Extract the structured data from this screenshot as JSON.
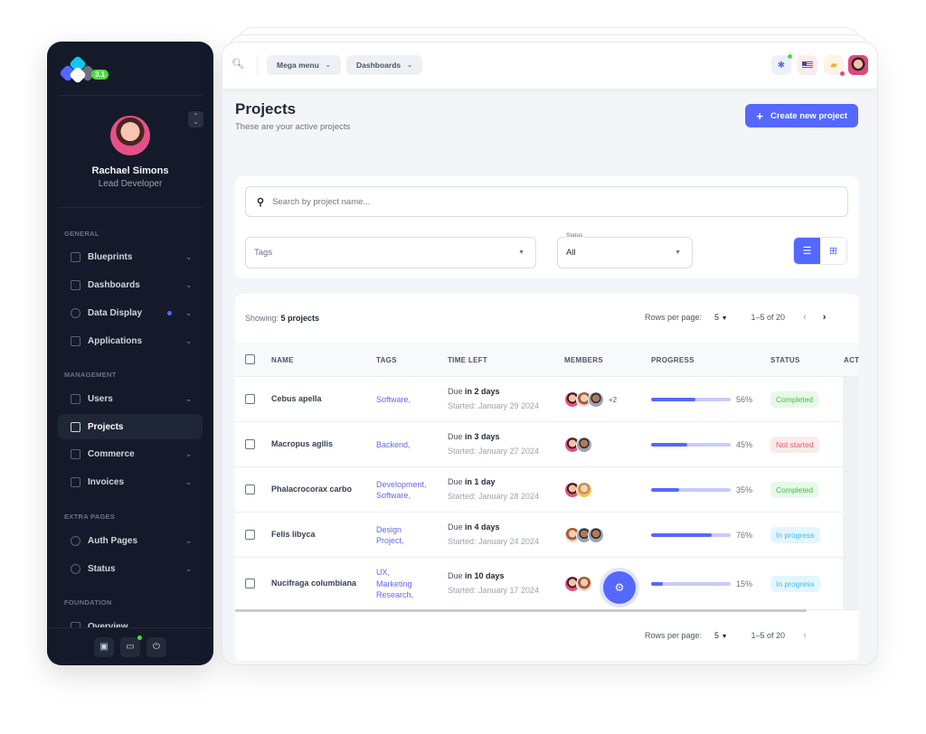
{
  "app": {
    "version": "3.1"
  },
  "user": {
    "name": "Rachael Simons",
    "role": "Lead Developer"
  },
  "sidebar": {
    "sections": [
      {
        "title": "GENERAL",
        "items": [
          {
            "label": "Blueprints",
            "icon": "blueprint-icon"
          },
          {
            "label": "Dashboards",
            "icon": "robot-icon"
          },
          {
            "label": "Data Display",
            "icon": "shield-icon",
            "dot": true
          },
          {
            "label": "Applications",
            "icon": "app-window-icon"
          }
        ]
      },
      {
        "title": "MANAGEMENT",
        "items": [
          {
            "label": "Users",
            "icon": "user-badge-icon"
          },
          {
            "label": "Projects",
            "icon": "hierarchy-icon",
            "active": true
          },
          {
            "label": "Commerce",
            "icon": "store-icon"
          },
          {
            "label": "Invoices",
            "icon": "invoice-icon"
          }
        ]
      },
      {
        "title": "EXTRA PAGES",
        "items": [
          {
            "label": "Auth Pages",
            "icon": "key-icon"
          },
          {
            "label": "Status",
            "icon": "alert-circle-icon"
          }
        ]
      },
      {
        "title": "FOUNDATION",
        "items": [
          {
            "label": "Overview",
            "icon": "grid-x-icon"
          }
        ]
      }
    ],
    "footer": {
      "calendar": "calendar-icon",
      "chat": "chat-icon",
      "power": "power-icon"
    }
  },
  "topbar": {
    "mega_menu": "Mega menu",
    "dashboards": "Dashboards",
    "icons": [
      "bug-icon",
      "us-flag-icon",
      "messages-icon"
    ]
  },
  "page": {
    "title": "Projects",
    "subtitle": "These are your active projects",
    "create_button": "Create new project"
  },
  "filters": {
    "search_placeholder": "Search by project name...",
    "tags_placeholder": "Tags",
    "status_label": "Status",
    "status_value": "All"
  },
  "table": {
    "showing_prefix": "Showing:",
    "showing_count": "5 projects",
    "rows_per_page_label": "Rows per page:",
    "rows_per_page": "5",
    "range": "1–5 of 20",
    "columns": [
      "NAME",
      "TAGS",
      "TIME LEFT",
      "MEMBERS",
      "PROGRESS",
      "STATUS",
      "ACT"
    ],
    "rows": [
      {
        "name": "Cebus apella",
        "tags": [
          "Software,"
        ],
        "due_prefix": "Due",
        "due": "in 2 days",
        "started": "Started: January 29 2024",
        "members": 3,
        "extra_members": "+2",
        "progress": 56,
        "progress_label": "56%",
        "status": "Completed"
      },
      {
        "name": "Macropus agilis",
        "tags": [
          "Backend,"
        ],
        "due_prefix": "Due",
        "due": "in 3 days",
        "started": "Started: January 27 2024",
        "members": 2,
        "extra_members": "",
        "progress": 45,
        "progress_label": "45%",
        "status": "Not started"
      },
      {
        "name": "Phalacrocorax carbo",
        "tags": [
          "Development,",
          "Software,"
        ],
        "due_prefix": "Due",
        "due": "in 1 day",
        "started": "Started: January 28 2024",
        "members": 2,
        "extra_members": "",
        "progress": 35,
        "progress_label": "35%",
        "status": "Completed"
      },
      {
        "name": "Felis libyca",
        "tags": [
          "Design",
          "Project,"
        ],
        "due_prefix": "Due",
        "due": "in 4 days",
        "started": "Started: January 24 2024",
        "members": 3,
        "extra_members": "",
        "progress": 76,
        "progress_label": "76%",
        "status": "In progress"
      },
      {
        "name": "Nucifraga columbiana",
        "tags": [
          "UX,",
          "Marketing",
          "Research,"
        ],
        "due_prefix": "Due",
        "due": "in 10 days",
        "started": "Started: January 17 2024",
        "members": 2,
        "extra_members": "",
        "progress": 15,
        "progress_label": "15%",
        "status": "In progress"
      }
    ]
  },
  "colors": {
    "accent": "#5568fe",
    "sidebar_bg": "#141a2a",
    "completed": "#3fbf3f",
    "not_started": "#e9567a",
    "in_progress": "#38bdf8"
  }
}
